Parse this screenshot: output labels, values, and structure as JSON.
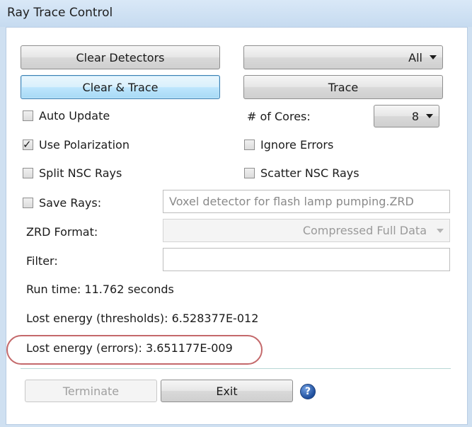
{
  "window": {
    "title": "Ray Trace Control"
  },
  "buttons": {
    "clear_detectors": "Clear Detectors",
    "clear_and_trace": "Clear & Trace",
    "trace": "Trace",
    "terminate": "Terminate",
    "exit": "Exit"
  },
  "detector_select": {
    "value": "All"
  },
  "checkboxes": {
    "auto_update": {
      "label": "Auto Update",
      "checked": false
    },
    "use_polarization": {
      "label": "Use Polarization",
      "checked": true
    },
    "split_nsc_rays": {
      "label": "Split NSC Rays",
      "checked": false
    },
    "ignore_errors": {
      "label": "Ignore Errors",
      "checked": false
    },
    "scatter_nsc_rays": {
      "label": "Scatter NSC Rays",
      "checked": false
    },
    "save_rays": {
      "label": "Save Rays:",
      "checked": false
    }
  },
  "cores": {
    "label": "# of Cores:",
    "value": "8"
  },
  "save_rays_file": {
    "value": "Voxel detector for flash lamp pumping.ZRD"
  },
  "zrd_format": {
    "label": "ZRD Format:",
    "value": "Compressed Full Data"
  },
  "filter": {
    "label": "Filter:",
    "value": ""
  },
  "status": {
    "run_time": "Run time: 11.762 seconds",
    "lost_energy_thresholds": "Lost energy (thresholds): 6.528377E-012",
    "lost_energy_errors": "Lost energy (errors): 3.651177E-009"
  },
  "help": {
    "glyph": "?"
  },
  "colors": {
    "highlight_ring": "#c4696b",
    "focus_border": "#3c7fb1"
  }
}
